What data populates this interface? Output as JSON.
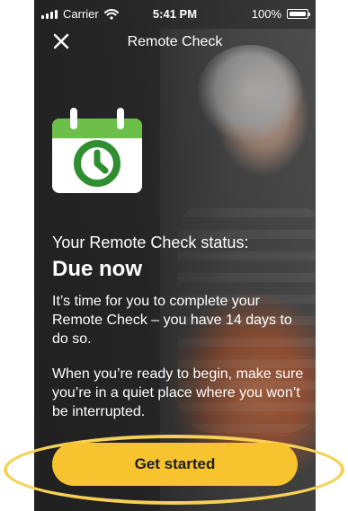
{
  "status_bar": {
    "carrier": "Carrier",
    "time": "5:41 PM",
    "battery": "100%",
    "icons": [
      "signal-icon",
      "wifi-icon",
      "battery-icon"
    ]
  },
  "nav": {
    "title": "Remote Check",
    "close_icon": "close-icon"
  },
  "illustration": {
    "icon": "calendar-clock-icon",
    "colors": {
      "green": "#6cc04a",
      "white": "#ffffff",
      "dark_green": "#2f8e2f"
    }
  },
  "content": {
    "status_label": "Your Remote Check status:",
    "status_value": "Due now",
    "paragraph_1": "It’s time for you to complete your Remote Check – you have 14 days to do so.",
    "paragraph_2": "When you’re ready to begin, make sure you’re in a quiet place where you won’t be interrupted."
  },
  "cta": {
    "label": "Get started",
    "button_color": "#f7c32f",
    "highlight_color": "#f6d155"
  }
}
